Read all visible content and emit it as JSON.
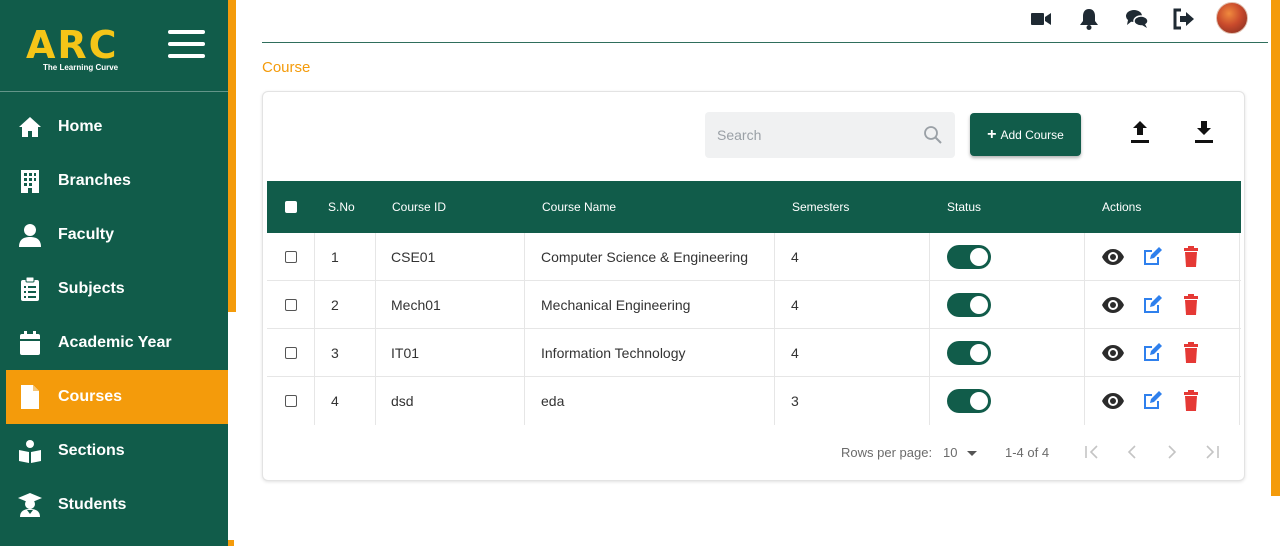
{
  "brand": {
    "name": "ARC",
    "tagline": "The Learning Curve"
  },
  "sidebar": {
    "items": [
      {
        "label": "Home",
        "icon": "home-icon",
        "active": false
      },
      {
        "label": "Branches",
        "icon": "building-icon",
        "active": false
      },
      {
        "label": "Faculty",
        "icon": "user-icon",
        "active": false
      },
      {
        "label": "Subjects",
        "icon": "clipboard-icon",
        "active": false
      },
      {
        "label": "Academic Year",
        "icon": "calendar-icon",
        "active": false
      },
      {
        "label": "Courses",
        "icon": "file-icon",
        "active": true
      },
      {
        "label": "Sections",
        "icon": "reader-icon",
        "active": false
      },
      {
        "label": "Students",
        "icon": "graduate-icon",
        "active": false
      }
    ]
  },
  "topbar": {
    "icons": [
      "video-icon",
      "bell-icon",
      "chat-icon",
      "logout-icon",
      "avatar"
    ]
  },
  "page": {
    "title": "Course"
  },
  "toolbar": {
    "search_placeholder": "Search",
    "add_label": "Add Course"
  },
  "table": {
    "headers": {
      "sno": "S.No",
      "course_id": "Course ID",
      "course_name": "Course Name",
      "semesters": "Semesters",
      "status": "Status",
      "actions": "Actions"
    },
    "rows": [
      {
        "sno": "1",
        "course_id": "CSE01",
        "course_name": "Computer Science & Engineering",
        "semesters": "4",
        "status": true
      },
      {
        "sno": "2",
        "course_id": "Mech01",
        "course_name": "Mechanical Engineering",
        "semesters": "4",
        "status": true
      },
      {
        "sno": "3",
        "course_id": "IT01",
        "course_name": "Information Technology",
        "semesters": "4",
        "status": true
      },
      {
        "sno": "4",
        "course_id": "dsd",
        "course_name": "eda",
        "semesters": "3",
        "status": true
      }
    ]
  },
  "pagination": {
    "rows_per_page_label": "Rows per page:",
    "rows_per_page": "10",
    "range": "1-4 of 4"
  },
  "colors": {
    "primary": "#115c4a",
    "accent": "#f49b0b",
    "logo": "#f5c518",
    "edit": "#2f80ed",
    "delete": "#e53935"
  }
}
